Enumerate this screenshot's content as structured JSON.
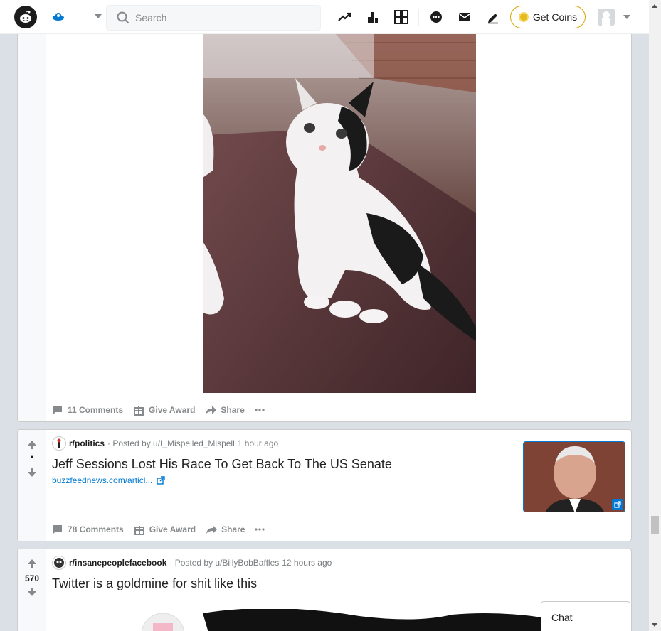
{
  "header": {
    "search_placeholder": "Search",
    "coins_label": "Get Coins"
  },
  "posts": [
    {
      "comments": "11 Comments",
      "award": "Give Award",
      "share": "Share"
    },
    {
      "votes": "•",
      "subreddit": "r/politics",
      "posted_by": "· Posted by u/I_Mispelled_Mispell",
      "time": "1 hour ago",
      "title": "Jeff Sessions Lost His Race To Get Back To The US Senate",
      "link": "buzzfeednews.com/articl...",
      "comments": "78 Comments",
      "award": "Give Award",
      "share": "Share"
    },
    {
      "votes": "570",
      "subreddit": "r/insanepeoplefacebook",
      "posted_by": "· Posted by u/BillyBobBaffles",
      "time": "12 hours ago",
      "title": "Twitter is a goldmine for shit like this"
    }
  ],
  "chat": {
    "label": "Chat"
  },
  "colors": {
    "accent": "#0079d3",
    "coin": "#d7a400",
    "background": "#dae0e6"
  }
}
